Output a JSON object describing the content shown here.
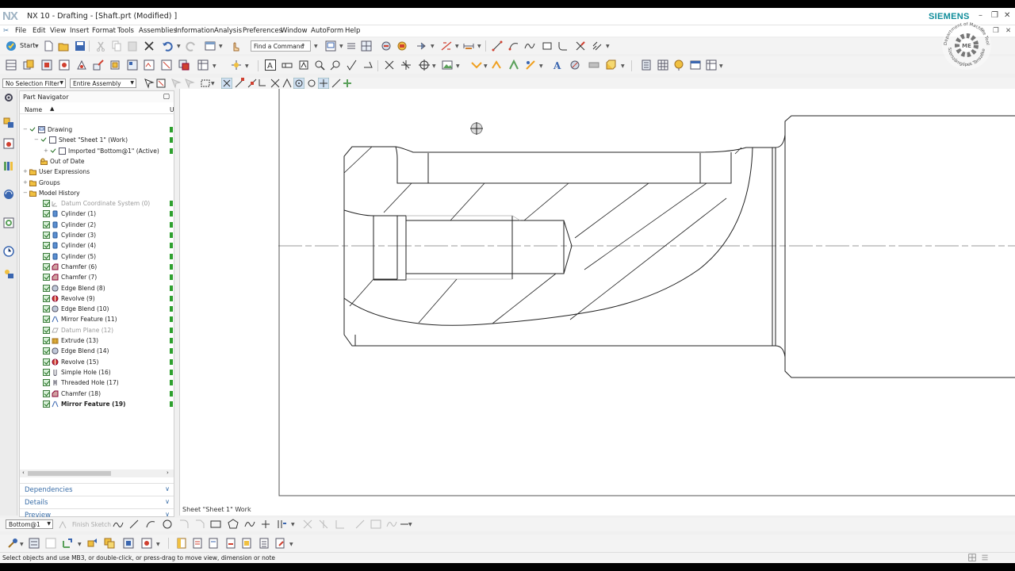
{
  "window": {
    "logo": "NX",
    "title": "NX 10 - Drafting - [Shaft.prt (Modified) ]",
    "brand": "SIEMENS",
    "controls": [
      "–",
      "❐",
      "✕"
    ]
  },
  "menu": [
    "File",
    "Edit",
    "View",
    "Insert",
    "Format",
    "Tools",
    "Assemblies",
    "Information",
    "Analysis",
    "Preferences",
    "Window",
    "AutoForm",
    "Help"
  ],
  "menu_controls": [
    "✎",
    "❐",
    "✕"
  ],
  "toolbar": {
    "start_label": "Start",
    "find_placeholder": "Find a Command"
  },
  "selection": {
    "filter": "No Selection Filter",
    "scope": "Entire Assembly"
  },
  "navigator": {
    "title": "Part Navigator",
    "col_name": "Name",
    "col_u": "U",
    "rows": [
      {
        "label": "Drawing",
        "indent": 0
      },
      {
        "label": "Sheet \"Sheet 1\" (Work)",
        "indent": 1
      },
      {
        "label": "Imported \"Bottom@1\" (Active)",
        "indent": 2
      },
      {
        "label": "Out of Date",
        "indent": 1
      },
      {
        "label": "User Expressions",
        "indent": 0
      },
      {
        "label": "Groups",
        "indent": 0
      },
      {
        "label": "Model History",
        "indent": 0
      },
      {
        "label": "Datum Coordinate System (0)",
        "indent": 1,
        "gray": true
      },
      {
        "label": "Cylinder (1)",
        "indent": 1
      },
      {
        "label": "Cylinder (2)",
        "indent": 1
      },
      {
        "label": "Cylinder (3)",
        "indent": 1
      },
      {
        "label": "Cylinder (4)",
        "indent": 1
      },
      {
        "label": "Cylinder (5)",
        "indent": 1
      },
      {
        "label": "Chamfer (6)",
        "indent": 1
      },
      {
        "label": "Chamfer (7)",
        "indent": 1
      },
      {
        "label": "Edge Blend (8)",
        "indent": 1
      },
      {
        "label": "Revolve (9)",
        "indent": 1
      },
      {
        "label": "Edge Blend (10)",
        "indent": 1
      },
      {
        "label": "Mirror Feature (11)",
        "indent": 1
      },
      {
        "label": "Datum Plane (12)",
        "indent": 1,
        "gray": true
      },
      {
        "label": "Extrude (13)",
        "indent": 1
      },
      {
        "label": "Edge Blend (14)",
        "indent": 1
      },
      {
        "label": "Revolve (15)",
        "indent": 1
      },
      {
        "label": "Simple Hole (16)",
        "indent": 1
      },
      {
        "label": "Threaded Hole (17)",
        "indent": 1
      },
      {
        "label": "Chamfer (18)",
        "indent": 1
      },
      {
        "label": "Mirror Feature (19)",
        "indent": 1,
        "bold": true
      }
    ],
    "panels": [
      "Dependencies",
      "Details",
      "Preview"
    ]
  },
  "sketch": {
    "view": "Bottom@1",
    "finish": "Finish Sketch"
  },
  "sheet_label": "Sheet \"Sheet 1\" Work",
  "status": "Select objects and use MB3, or double-click, or press-drag to move view, dimension or note",
  "seal": {
    "outer": "Department of Machine Tools",
    "inner": "Szerszámgépek Tanszéke",
    "center": "ME"
  },
  "colors": {
    "brand": "#0e8c9a",
    "check": "#2ea02e",
    "link": "#3a6ea8",
    "nx": "#9fb3c3"
  }
}
